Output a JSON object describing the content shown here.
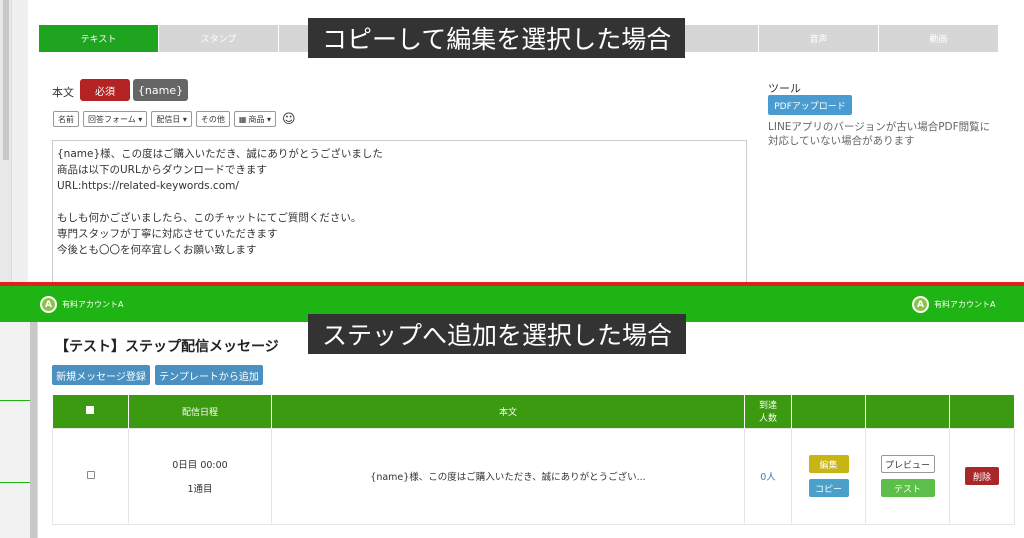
{
  "top": {
    "tabs": [
      "テキスト",
      "スタンプ",
      "",
      "",
      "",
      "",
      "音声",
      "動画"
    ],
    "overlay_title": "コピーして編集を選択した場合",
    "body_label": "本文",
    "required_badge": "必須",
    "name_badge": "{name}",
    "toolbar": [
      "名前",
      "回答フォーム ▾",
      "配信日 ▾",
      "その他",
      "商品 ▾"
    ],
    "editor_lines": [
      "{name}様、この度はご購入いただき、誠にありがとうございました",
      "商品は以下のURLからダウンロードできます",
      "URL:https://related-keywords.com/",
      "",
      "もしも何かございましたら、このチャットにてご質問ください。",
      "専門スタッフが丁寧に対応させていただきます",
      "今後とも〇〇を何卒宜しくお願い致します"
    ],
    "tools_label": "ツール",
    "pdf_button": "PDFアップロード",
    "pdf_note": "LINEアプリのバージョンが古い場合PDF閲覧に対応していない場合があります"
  },
  "bottom": {
    "account_left": "有料アカウントA",
    "account_right": "有料アカウントA",
    "avatar_letter": "A",
    "overlay_title": "ステップへ追加を選択した場合",
    "page_title": "【テスト】ステップ配信メッセージ",
    "btn_new": "新規メッセージ登録",
    "btn_template": "テンプレートから追加",
    "headers": [
      "",
      "配信日程",
      "本文",
      "到達人数",
      "",
      "",
      ""
    ],
    "header_reach_line1": "到達",
    "header_reach_line2": "人数",
    "row": {
      "schedule_line1": "0日目 00:00",
      "schedule_line2": "1通目",
      "body": "{name}様、この度はご購入いただき、誠にありがとうござい...",
      "reach": "0人",
      "edit": "編集",
      "copy": "コピー",
      "preview": "プレビュー",
      "test": "テスト",
      "delete": "削除"
    }
  }
}
